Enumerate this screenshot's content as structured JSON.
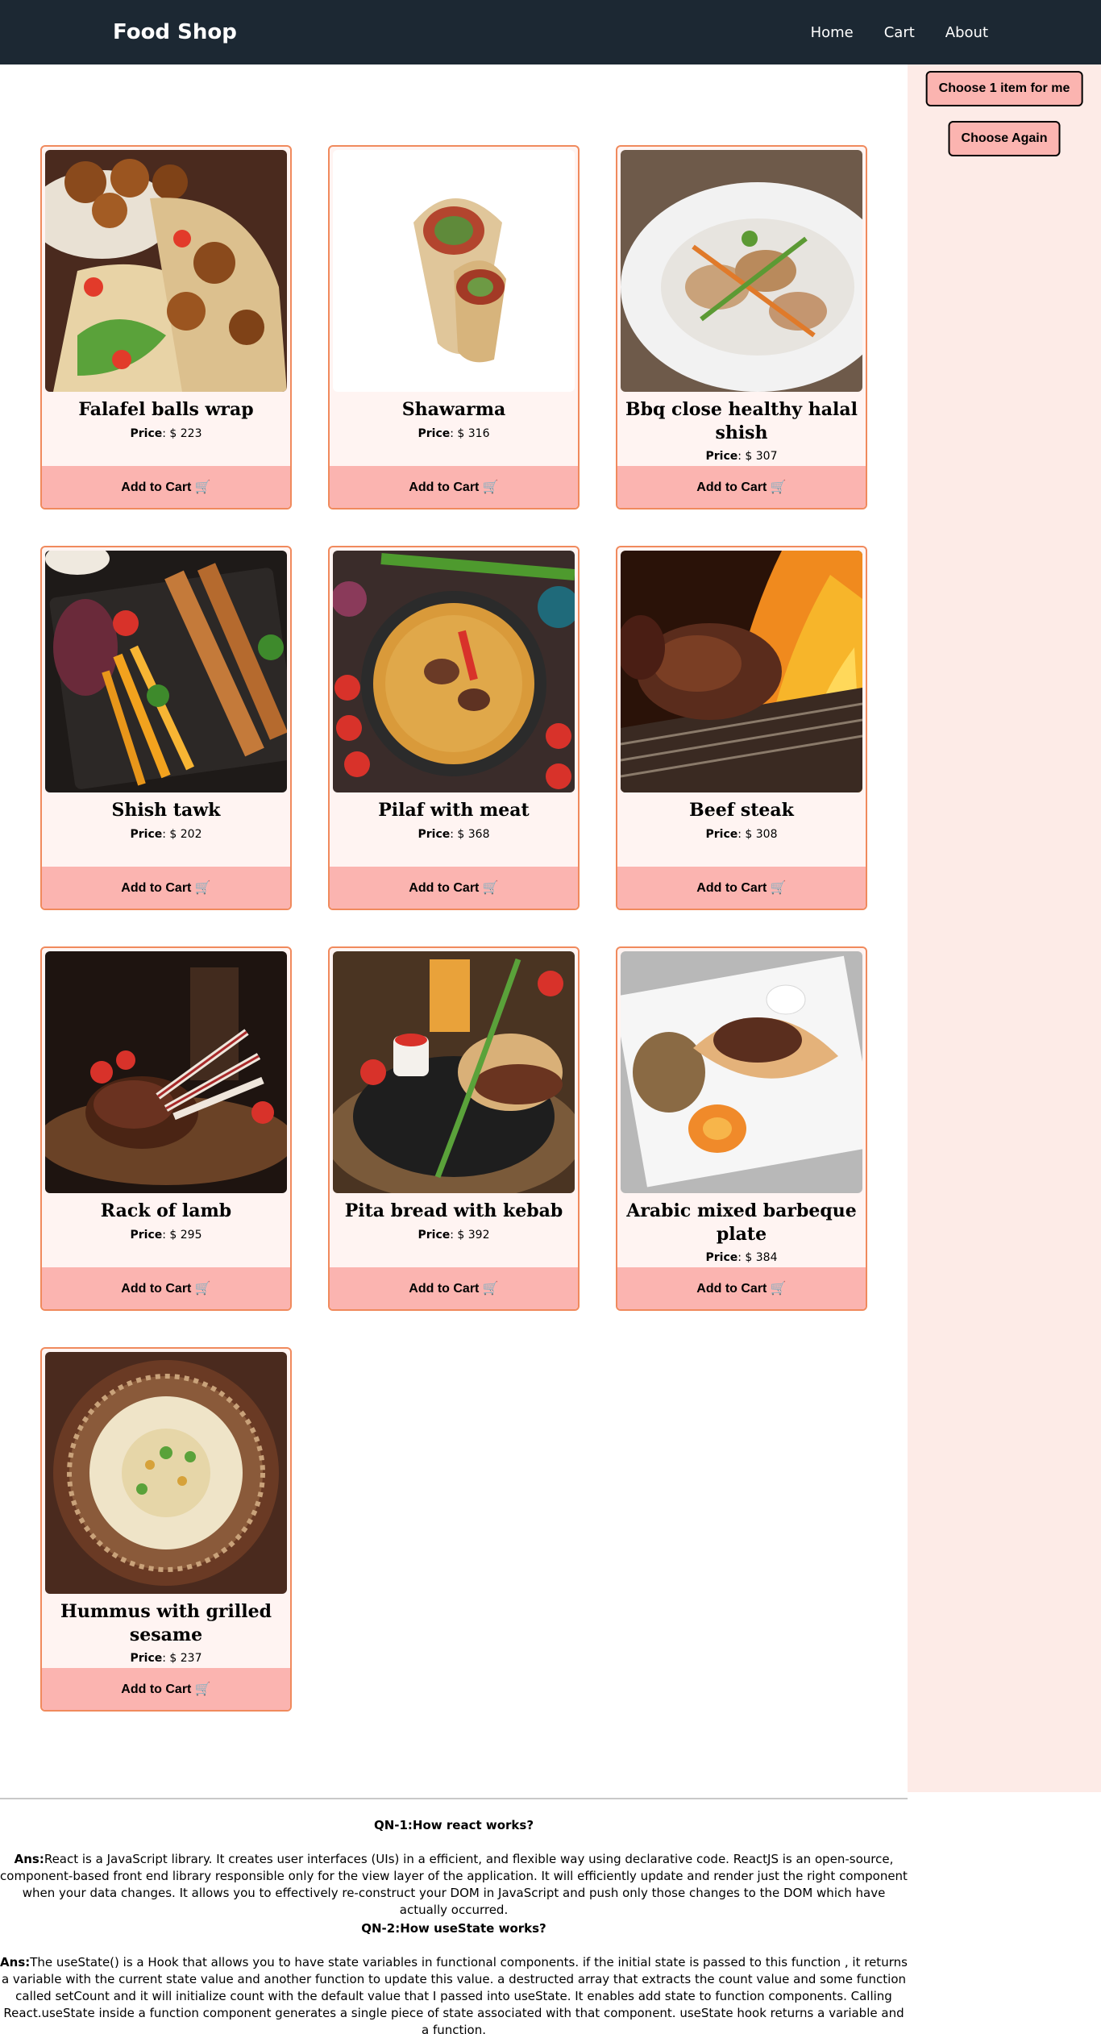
{
  "navbar": {
    "brand": "Food Shop",
    "links": [
      "Home",
      "Cart",
      "About"
    ]
  },
  "sidebar": {
    "choose_label": "Choose 1 item for me",
    "again_label": "Choose Again"
  },
  "products": [
    {
      "name": "Falafel balls wrap",
      "price_label": "Price",
      "price": ": $ 223",
      "button": "Add to Cart 🛒"
    },
    {
      "name": "Shawarma",
      "price_label": "Price",
      "price": ": $ 316",
      "button": "Add to Cart 🛒"
    },
    {
      "name": "Bbq close healthy halal shish",
      "price_label": "Price",
      "price": ": $ 307",
      "button": "Add to Cart 🛒"
    },
    {
      "name": "Shish tawk",
      "price_label": "Price",
      "price": ": $ 202",
      "button": "Add to Cart 🛒"
    },
    {
      "name": "Pilaf with meat",
      "price_label": "Price",
      "price": ": $ 368",
      "button": "Add to Cart 🛒"
    },
    {
      "name": "Beef steak",
      "price_label": "Price",
      "price": ": $ 308",
      "button": "Add to Cart 🛒"
    },
    {
      "name": "Rack of lamb",
      "price_label": "Price",
      "price": ": $ 295",
      "button": "Add to Cart 🛒"
    },
    {
      "name": "Pita bread with kebab",
      "price_label": "Price",
      "price": ": $ 392",
      "button": "Add to Cart 🛒"
    },
    {
      "name": "Arabic mixed barbeque plate",
      "price_label": "Price",
      "price": ": $ 384",
      "button": "Add to Cart 🛒"
    },
    {
      "name": "Hummus with grilled sesame",
      "price_label": "Price",
      "price": ": $ 237",
      "button": "Add to Cart 🛒"
    }
  ],
  "qa": [
    {
      "question": "QN-1:How react works?",
      "ans_label": "Ans:",
      "answer": "React is a JavaScript library. It creates user interfaces (UIs) in a efficient, and flexible way using declarative code. ReactJS is an open-source, component-based front end library responsible only for the view layer of the application. It will efficiently update and render just the right component when your data changes. It allows you to effectively re-construct your DOM in JavaScript and push only those changes to the DOM which have actually occurred."
    },
    {
      "question": "QN-2:How useState works?",
      "ans_label": "Ans:",
      "answer": "The useState() is a Hook that allows you to have state variables in functional components. if the initial state is passed to this function , it returns a variable with the current state value and another function to update this value. a destructed array that extracts the count value and some function called setCount and it will initialize count with the default value that I passed into useState. It enables add state to function components. Calling React.useState inside a function component generates a single piece of state associated with that component. useState hook returns a variable and a function."
    }
  ]
}
